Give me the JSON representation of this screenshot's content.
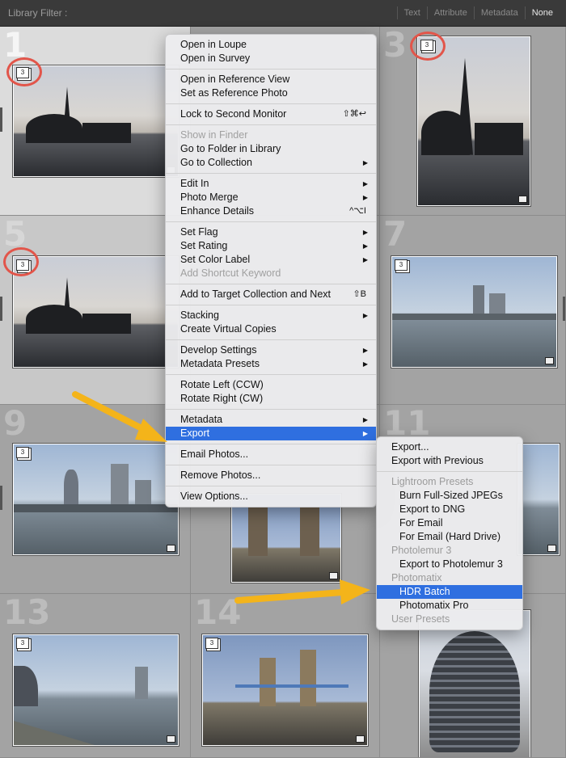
{
  "filter_bar": {
    "title": "Library Filter :",
    "options": [
      {
        "label": "Text",
        "selected": false
      },
      {
        "label": "Attribute",
        "selected": false
      },
      {
        "label": "Metadata",
        "selected": false
      },
      {
        "label": "None",
        "selected": true
      }
    ]
  },
  "grid": {
    "cells": [
      {
        "num": "1",
        "badge": "3"
      },
      {
        "num": "3",
        "badge": "3"
      },
      {
        "num": "5",
        "badge": "3"
      },
      {
        "num": "7",
        "badge": "3"
      },
      {
        "num": "9",
        "badge": "3"
      },
      {
        "num": "11",
        "badge": ""
      },
      {
        "num": "13",
        "badge": "3"
      },
      {
        "num": "14",
        "badge": "3"
      }
    ]
  },
  "context_menu": {
    "items": [
      {
        "label": "Open in Loupe"
      },
      {
        "label": "Open in Survey"
      },
      {
        "label": "Open in Reference View"
      },
      {
        "label": "Set as Reference Photo"
      },
      {
        "label": "Lock to Second Monitor",
        "shortcut": "⇧⌘↩"
      },
      {
        "label": "Show in Finder"
      },
      {
        "label": "Go to Folder in Library"
      },
      {
        "label": "Go to Collection"
      },
      {
        "label": "Edit In"
      },
      {
        "label": "Photo Merge"
      },
      {
        "label": "Enhance Details",
        "shortcut": "^⌥I"
      },
      {
        "label": "Set Flag"
      },
      {
        "label": "Set Rating"
      },
      {
        "label": "Set Color Label"
      },
      {
        "label": "Add Shortcut Keyword"
      },
      {
        "label": "Add to Target Collection and Next",
        "shortcut": "⇧B"
      },
      {
        "label": "Stacking"
      },
      {
        "label": "Create Virtual Copies"
      },
      {
        "label": "Develop Settings"
      },
      {
        "label": "Metadata Presets"
      },
      {
        "label": "Rotate Left (CCW)"
      },
      {
        "label": "Rotate Right (CW)"
      },
      {
        "label": "Metadata"
      },
      {
        "label": "Export"
      },
      {
        "label": "Email Photos..."
      },
      {
        "label": "Remove Photos..."
      },
      {
        "label": "View Options..."
      }
    ]
  },
  "export_submenu": {
    "items": [
      {
        "label": "Export..."
      },
      {
        "label": "Export with Previous"
      },
      {
        "label": "Lightroom Presets"
      },
      {
        "label": "Burn Full-Sized JPEGs"
      },
      {
        "label": "Export to DNG"
      },
      {
        "label": "For Email"
      },
      {
        "label": "For Email (Hard Drive)"
      },
      {
        "label": "Photolemur 3"
      },
      {
        "label": "Export to Photolemur 3"
      },
      {
        "label": "Photomatix"
      },
      {
        "label": "HDR Batch"
      },
      {
        "label": "Photomatix Pro"
      },
      {
        "label": "User Presets"
      }
    ]
  },
  "colors": {
    "highlight": "#2f6fe0",
    "annotation_ring": "#e2554a",
    "annotation_arrow": "#f4b41a"
  }
}
